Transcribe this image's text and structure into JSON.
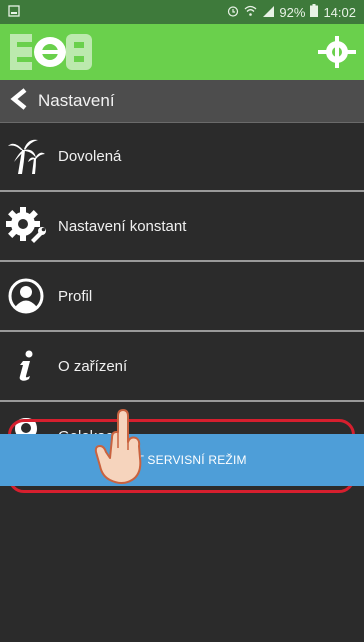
{
  "status_bar": {
    "battery": "92%",
    "time": "14:02",
    "icons": [
      "notification-icon",
      "alarm-icon",
      "wifi-icon",
      "signal-icon",
      "battery-icon"
    ]
  },
  "app_bar": {
    "logo_icon": "eob-logo",
    "action_icon": "target-icon",
    "color": "#6ad04c"
  },
  "toolbar": {
    "title": "Nastavení",
    "back_icon": "chevron-left-icon"
  },
  "menu": {
    "items": [
      {
        "label": "Dovolená",
        "icon": "palm-tree-icon"
      },
      {
        "label": "Nastavení konstant",
        "icon": "gear-wrench-icon"
      },
      {
        "label": "Profil",
        "icon": "user-circle-icon"
      },
      {
        "label": "O zařízení",
        "icon": "info-icon"
      },
      {
        "label": "Gelokace",
        "icon": "location-pin-icon"
      }
    ]
  },
  "service_button": {
    "label": "STIT SERVISNÍ REŽIM",
    "color": "#4e9ed8"
  },
  "highlight_color": "#d61f2e"
}
